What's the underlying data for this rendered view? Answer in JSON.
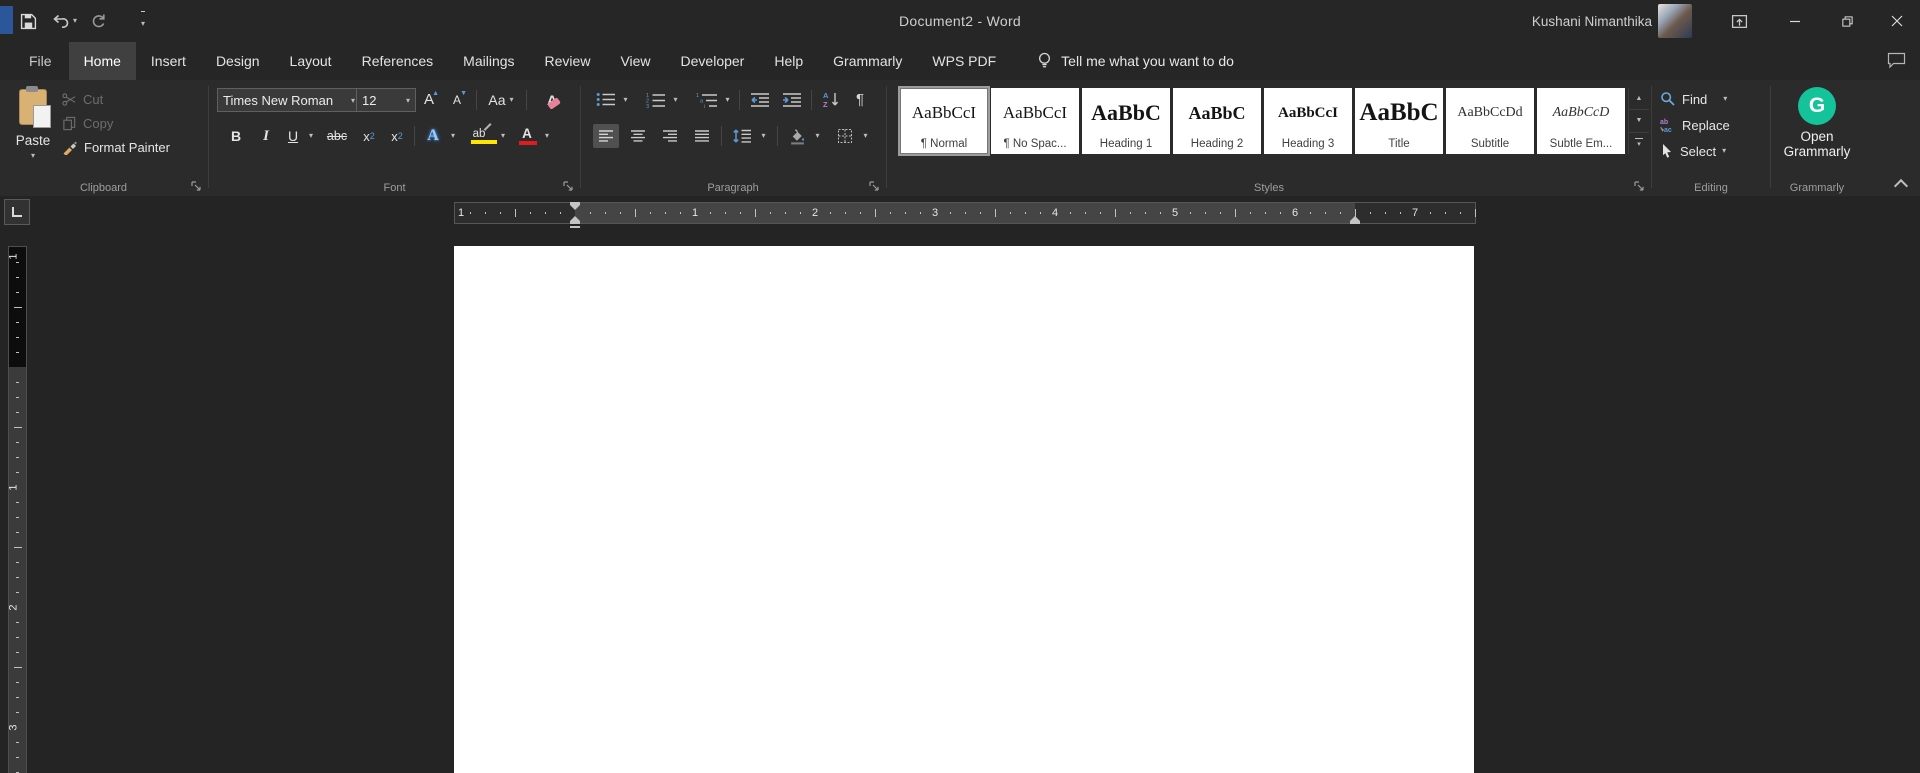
{
  "titlebar": {
    "title": "Document2  -  Word",
    "user_name": "Kushani Nimanthika"
  },
  "tabs": [
    {
      "label": "File",
      "active": false,
      "file": true
    },
    {
      "label": "Home",
      "active": true
    },
    {
      "label": "Insert"
    },
    {
      "label": "Design"
    },
    {
      "label": "Layout"
    },
    {
      "label": "References"
    },
    {
      "label": "Mailings"
    },
    {
      "label": "Review"
    },
    {
      "label": "View"
    },
    {
      "label": "Developer"
    },
    {
      "label": "Help"
    },
    {
      "label": "Grammarly"
    },
    {
      "label": "WPS PDF"
    }
  ],
  "tell_me": "Tell me what you want to do",
  "ribbon": {
    "clipboard": {
      "label": "Clipboard",
      "paste": "Paste",
      "cut": "Cut",
      "copy": "Copy",
      "format_painter": "Format Painter"
    },
    "font": {
      "label": "Font",
      "name": "Times New Roman",
      "size": "12",
      "grow_font": "A",
      "shrink_font": "A",
      "change_case": "Aa",
      "clear_formatting": "A",
      "bold": "B",
      "italic": "I",
      "underline": "U",
      "strikethrough": "abc",
      "subscript": {
        "base": "x",
        "script": "2"
      },
      "superscript": {
        "base": "x",
        "script": "2"
      },
      "text_effects": "A",
      "highlight": "ab",
      "font_color": "A"
    },
    "paragraph": {
      "label": "Paragraph",
      "pilcrow": "¶"
    },
    "styles": {
      "label": "Styles",
      "tiles": [
        {
          "sample": "AaBbCcI",
          "label": "¶ Normal",
          "style": "normal",
          "selected": true
        },
        {
          "sample": "AaBbCcI",
          "label": "¶ No Spac...",
          "style": "normal",
          "selected": false
        },
        {
          "sample": "AaBbC",
          "label": "Heading 1",
          "style": "h1",
          "selected": false
        },
        {
          "sample": "AaBbC",
          "label": "Heading 2",
          "style": "h2",
          "selected": false
        },
        {
          "sample": "AaBbCcI",
          "label": "Heading 3",
          "style": "h3",
          "selected": false
        },
        {
          "sample": "AaBbC",
          "label": "Title",
          "style": "title",
          "selected": false
        },
        {
          "sample": "AaBbCcDd",
          "label": "Subtitle",
          "style": "subtitle",
          "selected": false
        },
        {
          "sample": "AaBbCcD",
          "label": "Subtle Em...",
          "style": "subtle",
          "selected": false
        }
      ]
    },
    "editing": {
      "label": "Editing",
      "find": "Find",
      "replace": "Replace",
      "select": "Select"
    },
    "grammarly": {
      "label": "Grammarly",
      "logo_letter": "G",
      "button": "Open Grammarly"
    }
  },
  "ruler": {
    "h_labels": [
      "1",
      "",
      "1",
      "2",
      "3",
      "4",
      "5",
      "6",
      "7"
    ],
    "v_labels": [
      "1",
      "",
      "1",
      "2",
      "3"
    ]
  },
  "colors": {
    "word_blue": "#2b579a",
    "grammarly_green": "#15c39a",
    "accent_blue": "#5b9bd5",
    "highlight_yellow": "#ffe600",
    "font_color_red": "#e21c1c",
    "chrome_bg": "#262626",
    "ribbon_bg": "#2b2b2b",
    "page_white": "#ffffff"
  }
}
